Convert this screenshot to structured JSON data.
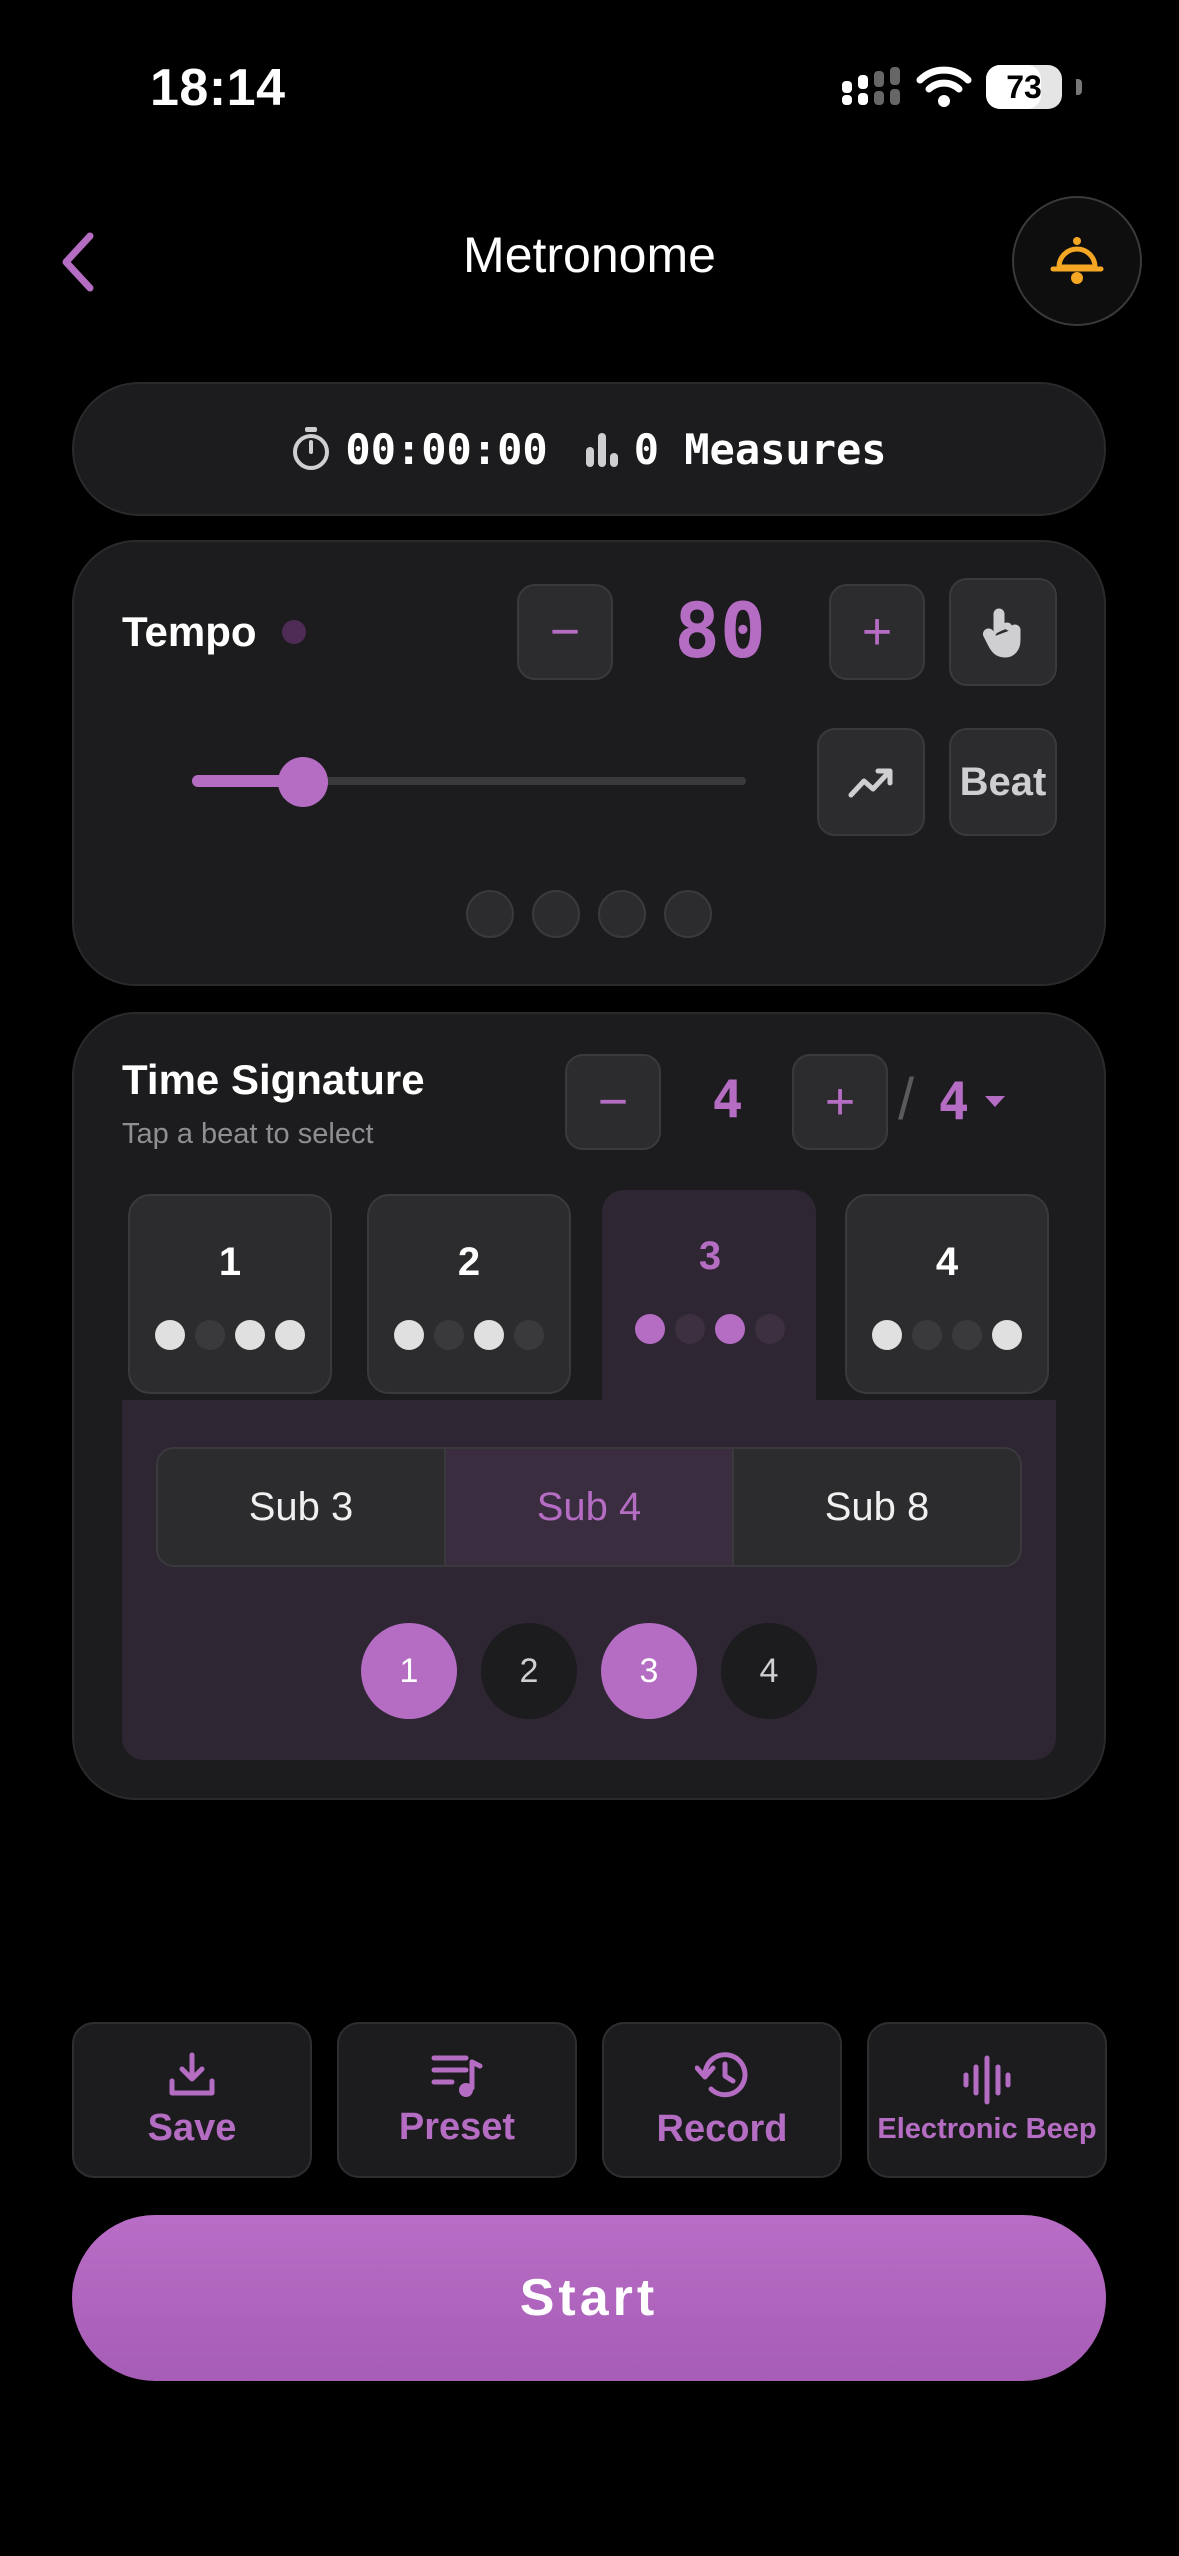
{
  "status_bar": {
    "time": "18:14",
    "battery": "73",
    "battery_level": 0.73
  },
  "header": {
    "title": "Metronome",
    "back_icon": "chevron-left-icon",
    "bell_icon": "bell-icon"
  },
  "stats": {
    "elapsed": "00:00:00",
    "measures": "0 Measures"
  },
  "tempo": {
    "label": "Tempo",
    "value": "80",
    "minus": "−",
    "plus": "+",
    "slider_level": 0.2,
    "beat_button": "Beat"
  },
  "time_signature": {
    "label": "Time Signature",
    "hint": "Tap a beat to select",
    "minus": "−",
    "plus": "+",
    "numerator": "4",
    "slash": "/",
    "denominator": "4",
    "beats": [
      {
        "number": "1",
        "pattern": [
          1,
          0,
          1,
          1
        ]
      },
      {
        "number": "2",
        "pattern": [
          1,
          0,
          1,
          0
        ]
      },
      {
        "number": "3",
        "pattern": [
          1,
          0,
          1,
          0
        ],
        "selected": true
      },
      {
        "number": "4",
        "pattern": [
          1,
          0,
          0,
          1
        ]
      }
    ],
    "subdivisions": [
      "Sub 3",
      "Sub 4",
      "Sub 8"
    ],
    "active_subdivision": "Sub 4",
    "sub_beats": [
      "1",
      "2",
      "3",
      "4"
    ],
    "sub_beats_active": [
      true,
      false,
      true,
      false
    ]
  },
  "actions": {
    "save": "Save",
    "preset": "Preset",
    "record": "Record",
    "sound": "Electronic Beep"
  },
  "start_button": "Start",
  "colors": {
    "accent": "#b56dc4",
    "card": "#1c1c1e",
    "bell": "#f5a623"
  }
}
